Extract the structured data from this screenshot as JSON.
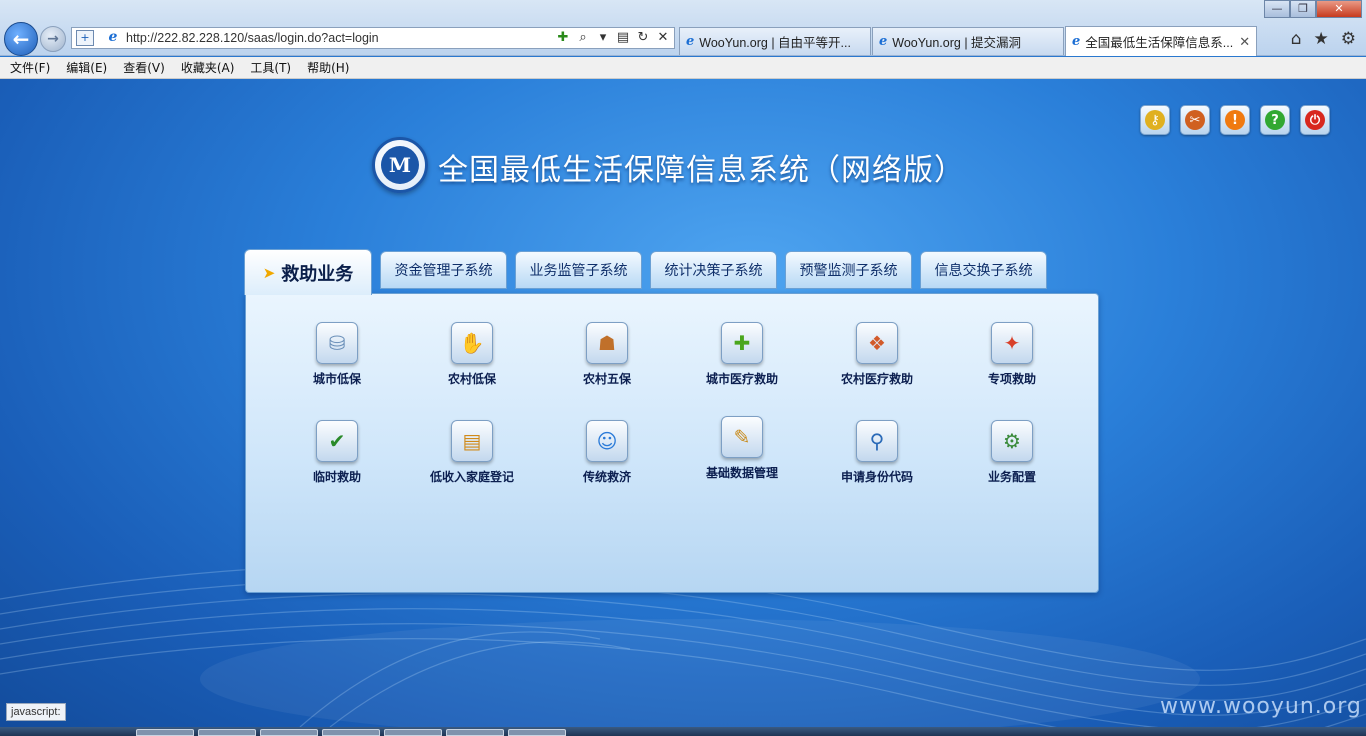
{
  "browser": {
    "back": "←",
    "forward": "→",
    "compat": "+",
    "ie_glyph": "e",
    "url": "http://222.82.228.120/saas/login.do?act=login",
    "addr_tools": [
      "✚",
      "⌕",
      "▾",
      "▤",
      "↻",
      "✕"
    ],
    "tabs": [
      {
        "title": "WooYun.org | 自由平等开...",
        "close": ""
      },
      {
        "title": "WooYun.org | 提交漏洞",
        "close": ""
      },
      {
        "title": "全国最低生活保障信息系...",
        "close": "✕"
      }
    ],
    "window": {
      "minimize": "—",
      "maximize": "❐",
      "close": "✕"
    },
    "right_icons": [
      "⌂",
      "★",
      "⚙"
    ],
    "menu": [
      "文件(F)",
      "编辑(E)",
      "查看(V)",
      "收藏夹(A)",
      "工具(T)",
      "帮助(H)"
    ]
  },
  "page": {
    "title": "全国最低生活保障信息系统（网络版）",
    "logo_glyph": "M",
    "toolbar": [
      {
        "icon": "key-icon",
        "glyph": "⚷",
        "color": "#e0b020"
      },
      {
        "icon": "tools-icon",
        "glyph": "✂",
        "color": "#d06020"
      },
      {
        "icon": "message-icon",
        "glyph": "!",
        "color": "#f07a10"
      },
      {
        "icon": "help-icon",
        "glyph": "?",
        "color": "#32a832"
      },
      {
        "icon": "power-icon",
        "glyph": "⏻",
        "color": "#d8281e"
      }
    ],
    "tabs": [
      {
        "label": "救助业务",
        "active": true,
        "cursor": "➤"
      },
      {
        "label": "资金管理子系统"
      },
      {
        "label": "业务监管子系统"
      },
      {
        "label": "统计决策子系统"
      },
      {
        "label": "预警监测子系统"
      },
      {
        "label": "信息交换子系统"
      }
    ],
    "functions": [
      {
        "label": "城市低保",
        "icon": "database-icon",
        "glyph": "⛁"
      },
      {
        "label": "农村低保",
        "icon": "hands-icon",
        "glyph": "✋"
      },
      {
        "label": "农村五保",
        "icon": "elder-icon",
        "glyph": "☗"
      },
      {
        "label": "城市医疗救助",
        "icon": "medical-icon",
        "glyph": "✚"
      },
      {
        "label": "农村医疗救助",
        "icon": "farm-medical-icon",
        "glyph": "❖"
      },
      {
        "label": "专项救助",
        "icon": "special-aid-icon",
        "glyph": "✦"
      },
      {
        "label": "临时救助",
        "icon": "checklist-icon",
        "glyph": "✔"
      },
      {
        "label": "低收入家庭登记",
        "icon": "register-icon",
        "glyph": "▤"
      },
      {
        "label": "传统救济",
        "icon": "person-icon",
        "glyph": "☺"
      },
      {
        "label": "基础数据管理",
        "icon": "data-edit-icon",
        "glyph": "✎"
      },
      {
        "label": "申请身份代码",
        "icon": "search-person-icon",
        "glyph": "⚲"
      },
      {
        "label": "业务配置",
        "icon": "config-icon",
        "glyph": "⚙"
      }
    ]
  },
  "status": {
    "text": "javascript:"
  },
  "watermark": "www.wooyun.org"
}
